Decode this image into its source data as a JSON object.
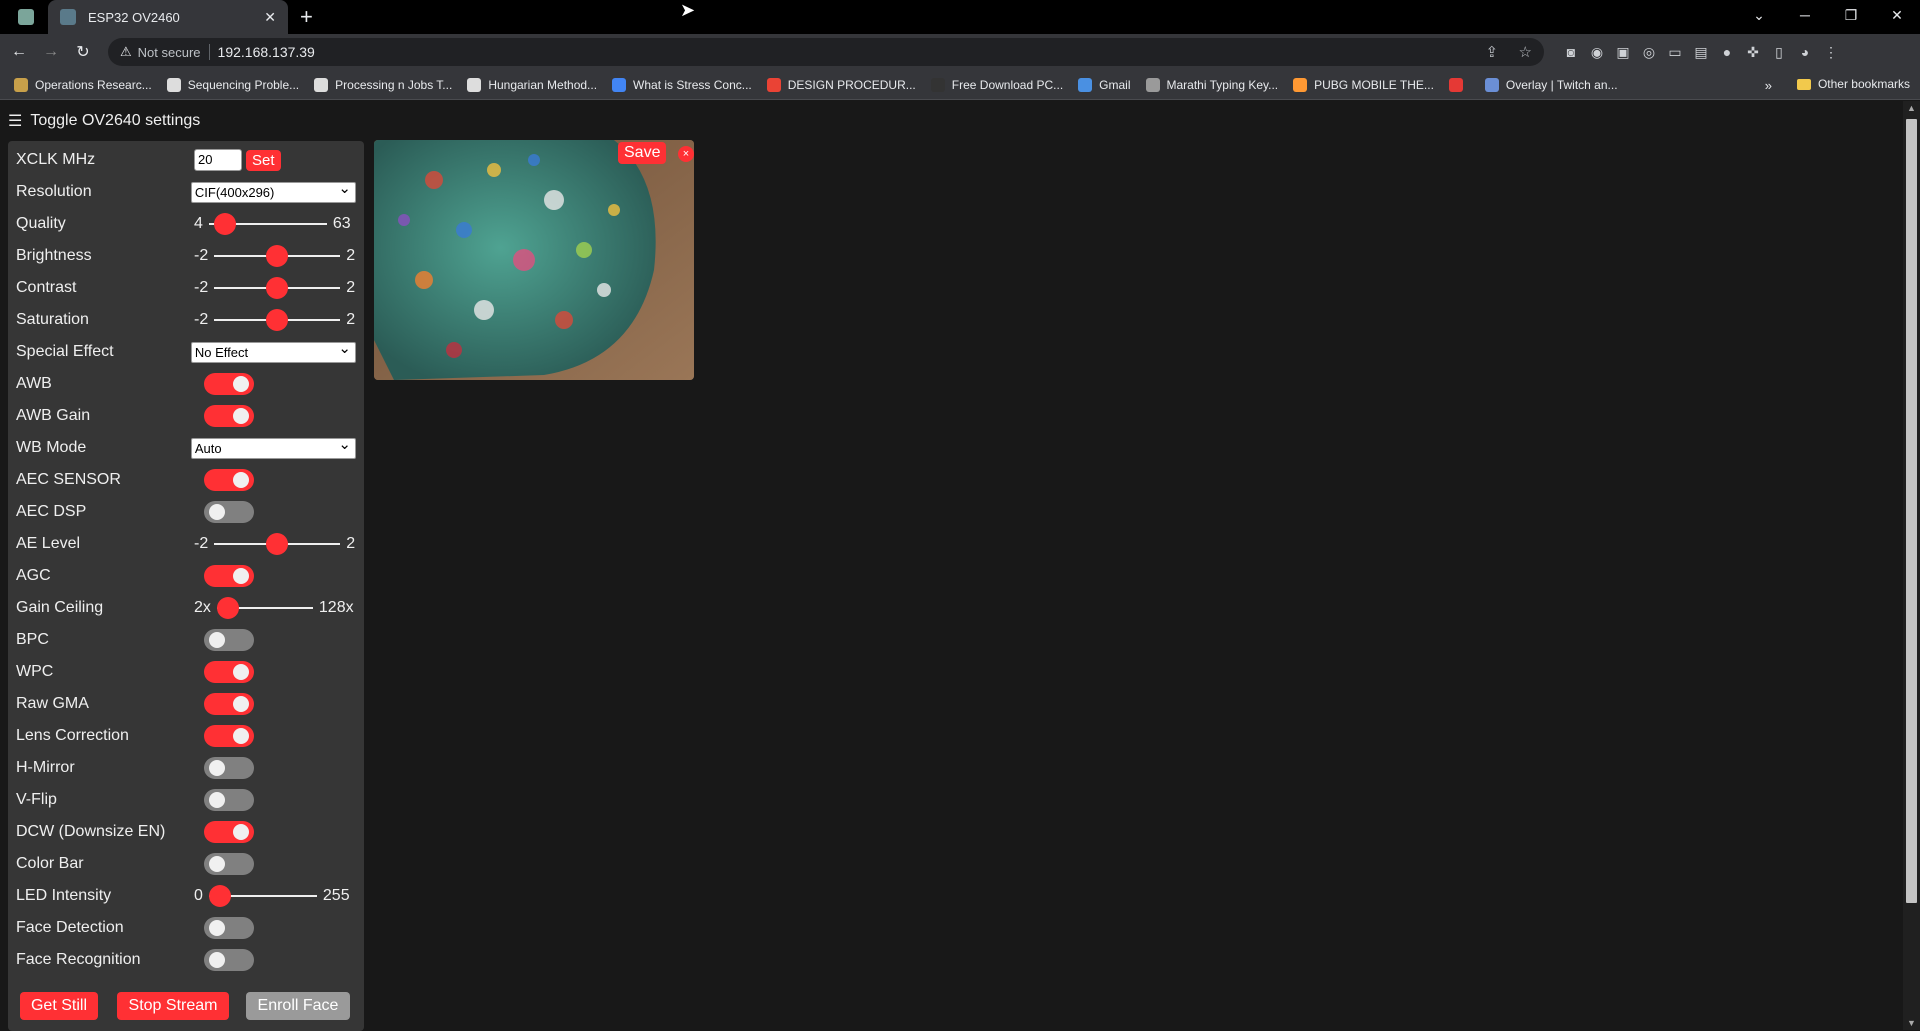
{
  "browser": {
    "tab_title": "ESP32 OV2460",
    "not_secure": "Not secure",
    "url": "192.168.137.39",
    "bookmarks": [
      {
        "label": "Operations Researc...",
        "color": "#c8a04a"
      },
      {
        "label": "Sequencing Proble...",
        "color": "#dddddd"
      },
      {
        "label": "Processing n Jobs T...",
        "color": "#dddddd"
      },
      {
        "label": "Hungarian Method...",
        "color": "#dddddd"
      },
      {
        "label": "What is Stress Conc...",
        "color": "#4285f4"
      },
      {
        "label": "DESIGN PROCEDUR...",
        "color": "#ea4335"
      },
      {
        "label": "Free Download PC...",
        "color": "#333333"
      },
      {
        "label": "Gmail",
        "color": "#4a90e2"
      },
      {
        "label": "Marathi Typing Key...",
        "color": "#9a9a9a"
      },
      {
        "label": "PUBG MOBILE THE...",
        "color": "#ff9933"
      },
      {
        "label": "",
        "color": "#e53935"
      },
      {
        "label": "Overlay | Twitch an...",
        "color": "#6b8fd6"
      }
    ],
    "other_bookmarks": "Other bookmarks"
  },
  "page": {
    "toggle_settings": "Toggle OV2640 settings",
    "xclk": {
      "label": "XCLK MHz",
      "value": "20",
      "set_label": "Set"
    },
    "resolution": {
      "label": "Resolution",
      "value": "CIF(400x296)"
    },
    "quality": {
      "label": "Quality",
      "min": "4",
      "max": "63",
      "value": 0.05
    },
    "brightness": {
      "label": "Brightness",
      "min": "-2",
      "max": "2",
      "value": 0.5
    },
    "contrast": {
      "label": "Contrast",
      "min": "-2",
      "max": "2",
      "value": 0.5
    },
    "saturation": {
      "label": "Saturation",
      "min": "-2",
      "max": "2",
      "value": 0.5
    },
    "special_effect": {
      "label": "Special Effect",
      "value": "No Effect"
    },
    "awb": {
      "label": "AWB",
      "on": true
    },
    "awb_gain": {
      "label": "AWB Gain",
      "on": true
    },
    "wb_mode": {
      "label": "WB Mode",
      "value": "Auto"
    },
    "aec_sensor": {
      "label": "AEC SENSOR",
      "on": true
    },
    "aec_dsp": {
      "label": "AEC DSP",
      "on": false
    },
    "ae_level": {
      "label": "AE Level",
      "min": "-2",
      "max": "2",
      "value": 0.5
    },
    "agc": {
      "label": "AGC",
      "on": true
    },
    "gain_ceiling": {
      "label": "Gain Ceiling",
      "min": "2x",
      "max": "128x",
      "value": 0.0
    },
    "bpc": {
      "label": "BPC",
      "on": false
    },
    "wpc": {
      "label": "WPC",
      "on": true
    },
    "raw_gma": {
      "label": "Raw GMA",
      "on": true
    },
    "lens_correction": {
      "label": "Lens Correction",
      "on": true
    },
    "h_mirror": {
      "label": "H-Mirror",
      "on": false
    },
    "v_flip": {
      "label": "V-Flip",
      "on": false
    },
    "dcw": {
      "label": "DCW (Downsize EN)",
      "on": true
    },
    "color_bar": {
      "label": "Color Bar",
      "on": false
    },
    "led_intensity": {
      "label": "LED Intensity",
      "min": "0",
      "max": "255",
      "value": 0.0
    },
    "face_detection": {
      "label": "Face Detection",
      "on": false
    },
    "face_recognition": {
      "label": "Face Recognition",
      "on": false
    },
    "get_still": "Get Still",
    "stop_stream": "Stop Stream",
    "enroll_face": "Enroll Face",
    "save": "Save",
    "close": "×"
  }
}
